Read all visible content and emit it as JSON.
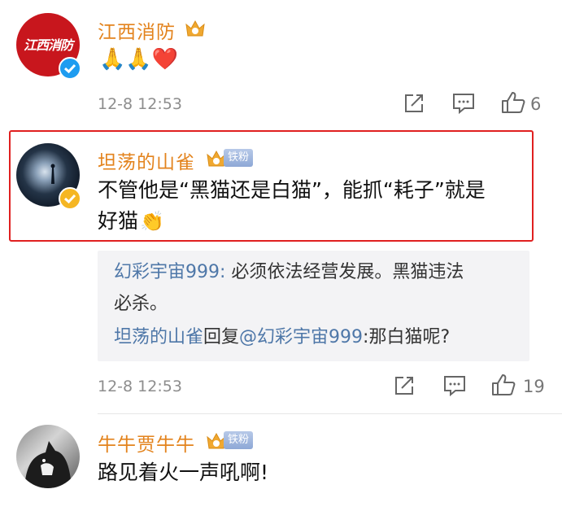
{
  "comments": [
    {
      "username": "江西消防",
      "avatar_text": "江西消防",
      "content_emoji": "🙏🙏❤️",
      "time": "12-8 12:53",
      "likes": "6"
    },
    {
      "username": "坦荡的山雀",
      "badge": "铁粉",
      "content": "不管他是“黑猫还是白猫”，能抓“耗子”就是好猫",
      "content_line1": "不管他是“黑猫还是白猫”，能抓“耗子”就是",
      "content_line2": "好猫",
      "replies": [
        {
          "author": "幻彩宇宙999",
          "separator": ": ",
          "text": "必须依法经营发展。黑猫违法",
          "text2": "必杀。"
        },
        {
          "author": "坦荡的山雀",
          "reply_word": "回复",
          "mention": "@幻彩宇宙999",
          "text": ":那白猫呢?"
        }
      ],
      "time": "12-8 12:53",
      "likes": "19"
    },
    {
      "username": "牛牛贾牛牛",
      "badge": "铁粉",
      "content": "路见着火一声吼啊!"
    }
  ],
  "colors": {
    "username": "#e3831d",
    "reply_link": "#4e77a8",
    "highlight": "#e02020"
  }
}
